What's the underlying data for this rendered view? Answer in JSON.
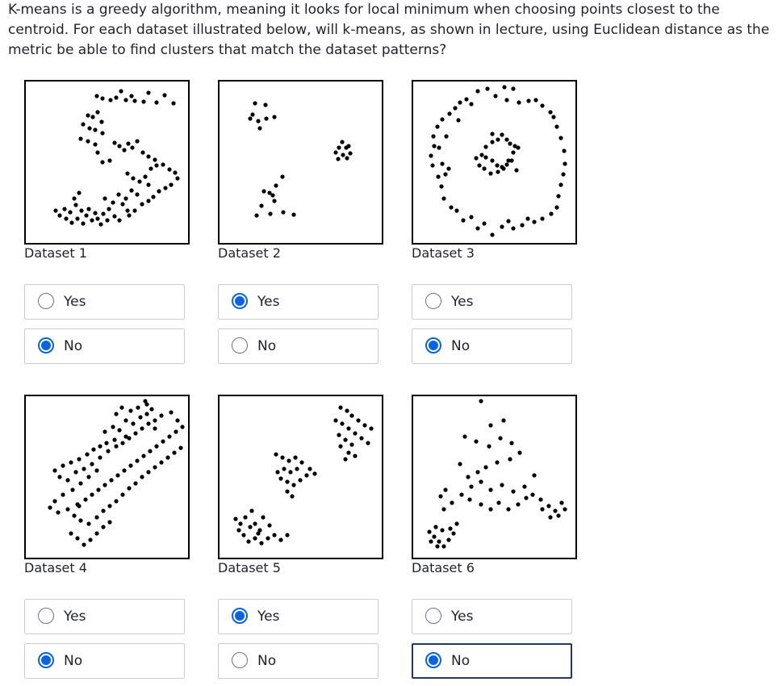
{
  "question": "K-means is a greedy algorithm, meaning it looks for local minimum when choosing points closest to the centroid. For each dataset illustrated below, will k-means, as shown in lecture, using Euclidean distance as the metric be able to find clusters that match the dataset patterns?",
  "datasets": [
    {
      "label": "Dataset 1",
      "yes": "Yes",
      "no": "No",
      "selected": "No"
    },
    {
      "label": "Dataset 2",
      "yes": "Yes",
      "no": "No",
      "selected": "Yes"
    },
    {
      "label": "Dataset 3",
      "yes": "Yes",
      "no": "No",
      "selected": "No"
    },
    {
      "label": "Dataset 4",
      "yes": "Yes",
      "no": "No",
      "selected": "No"
    },
    {
      "label": "Dataset 5",
      "yes": "Yes",
      "no": "No",
      "selected": "Yes"
    },
    {
      "label": "Dataset 6",
      "yes": "Yes",
      "no": "No",
      "selected": "No"
    }
  ],
  "colors": {
    "radio_selected": "#0a63e0",
    "border": "#c9cdd2",
    "focus_border": "#1e3a5f"
  }
}
